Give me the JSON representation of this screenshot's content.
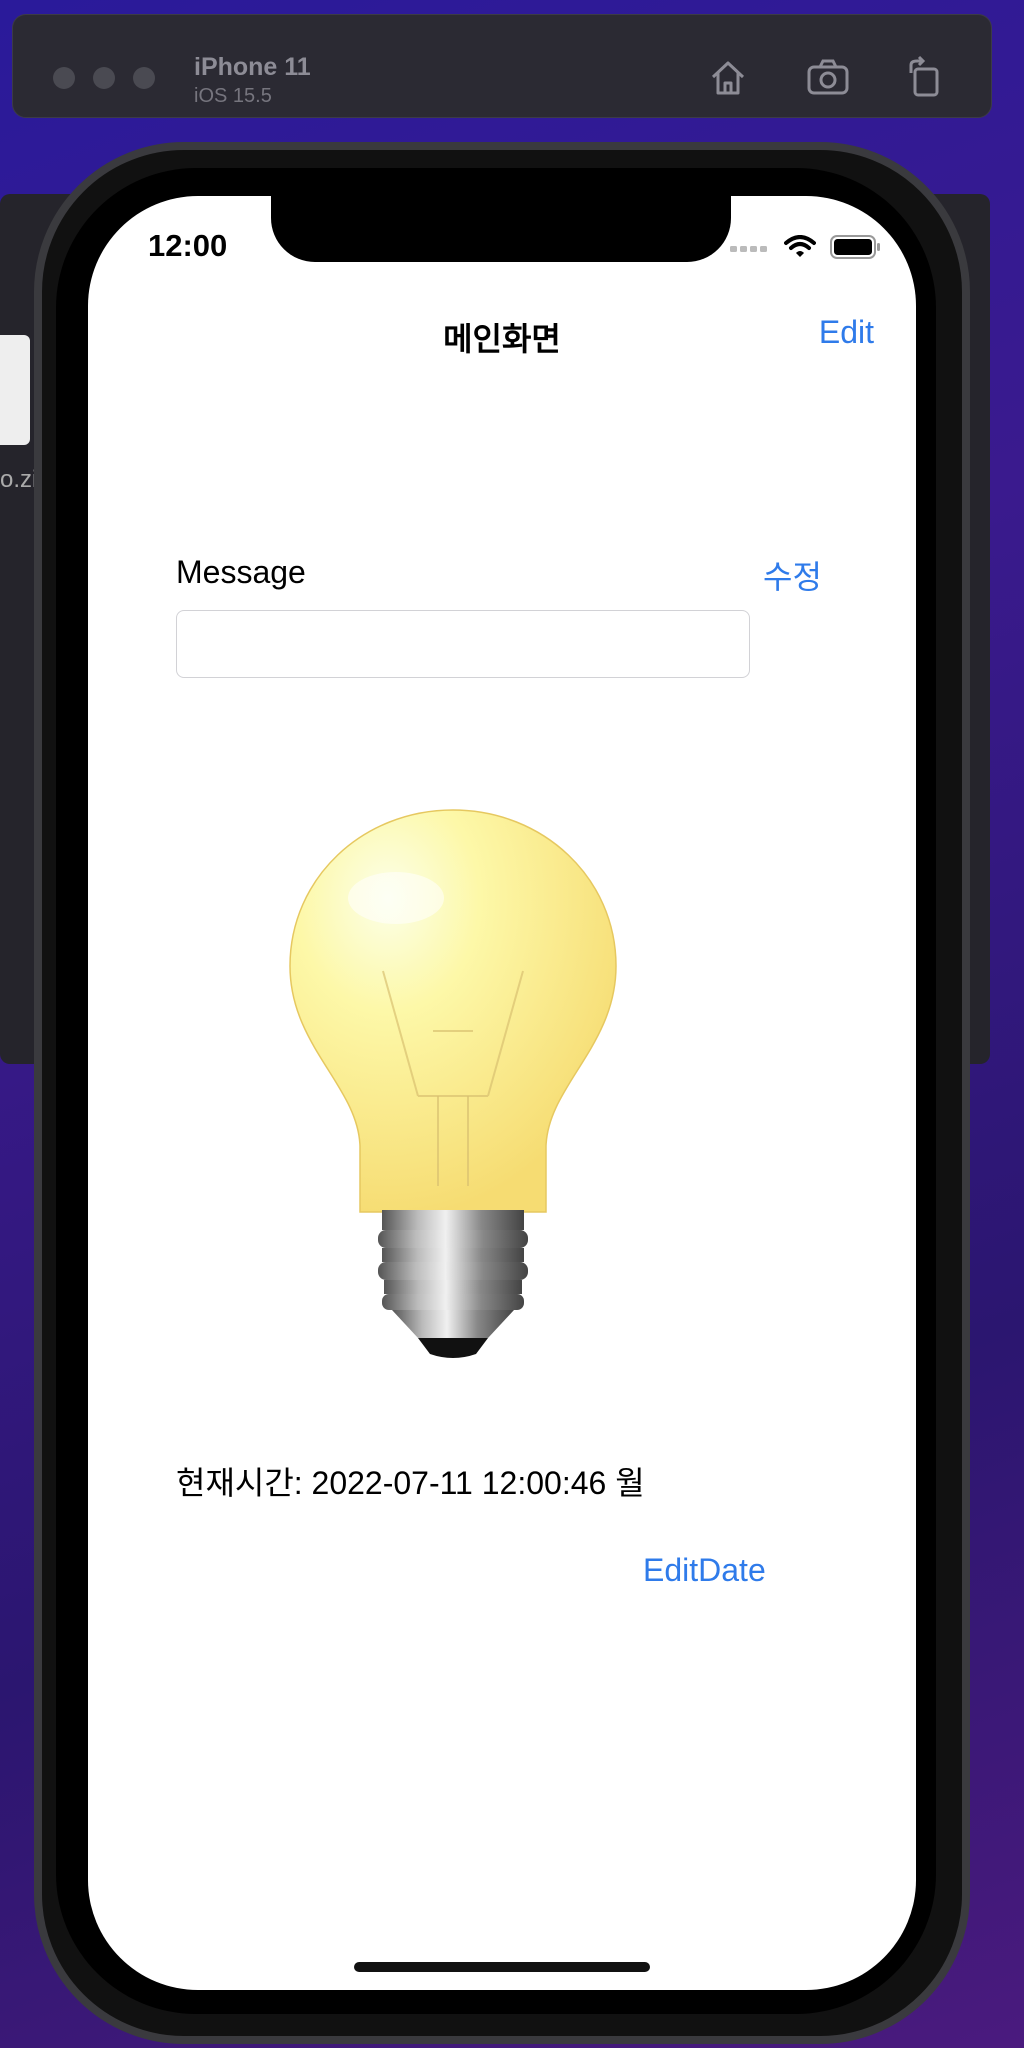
{
  "simulator": {
    "device_name": "iPhone 11",
    "os_version": "iOS 15.5",
    "toolbar_icons": [
      "home-icon",
      "screenshot-icon",
      "rotate-icon"
    ]
  },
  "background": {
    "file_label": "o.zi"
  },
  "status_bar": {
    "time": "12:00"
  },
  "nav": {
    "title": "메인화면",
    "edit_label": "Edit"
  },
  "message": {
    "label": "Message",
    "edit_label": "수정",
    "input_value": "",
    "input_placeholder": ""
  },
  "current_time": {
    "text": "현재시간: 2022-07-11 12:00:46 월"
  },
  "edit_date_label": "EditDate",
  "colors": {
    "accent": "#2f7bea",
    "screen_bg": "#ffffff",
    "desktop_bg": "#2a1a9a"
  }
}
